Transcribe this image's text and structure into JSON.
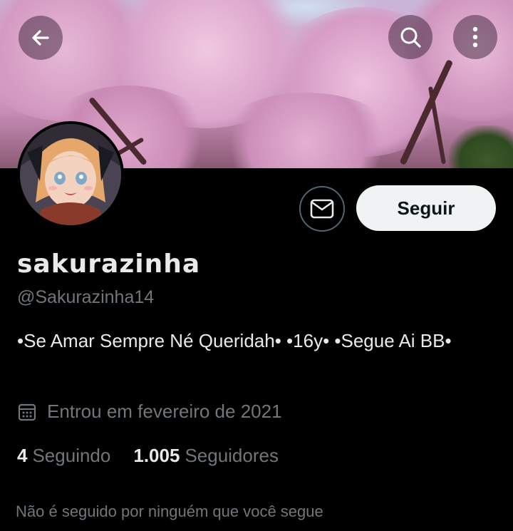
{
  "header": {
    "back_icon": "arrow-left-icon",
    "search_icon": "search-icon",
    "more_icon": "more-vertical-icon"
  },
  "profile": {
    "display_name": "sakurazinha",
    "handle": "@Sakurazinha14",
    "bio": "•Se Amar Sempre Né Queridah• •16y• •Segue Ai BB•",
    "joined": "Entrou em fevereiro de 2021",
    "following_count": "4",
    "following_label": "Seguindo",
    "followers_count": "1.005",
    "followers_label": "Seguidores",
    "not_followed_note": "Não é seguido por ninguém que você segue"
  },
  "actions": {
    "follow_label": "Seguir",
    "message_icon": "envelope-icon"
  },
  "colors": {
    "background": "#000000",
    "primary_text": "#e7e9ea",
    "secondary_text": "#71767b",
    "follow_button_bg": "#eff3f4"
  }
}
